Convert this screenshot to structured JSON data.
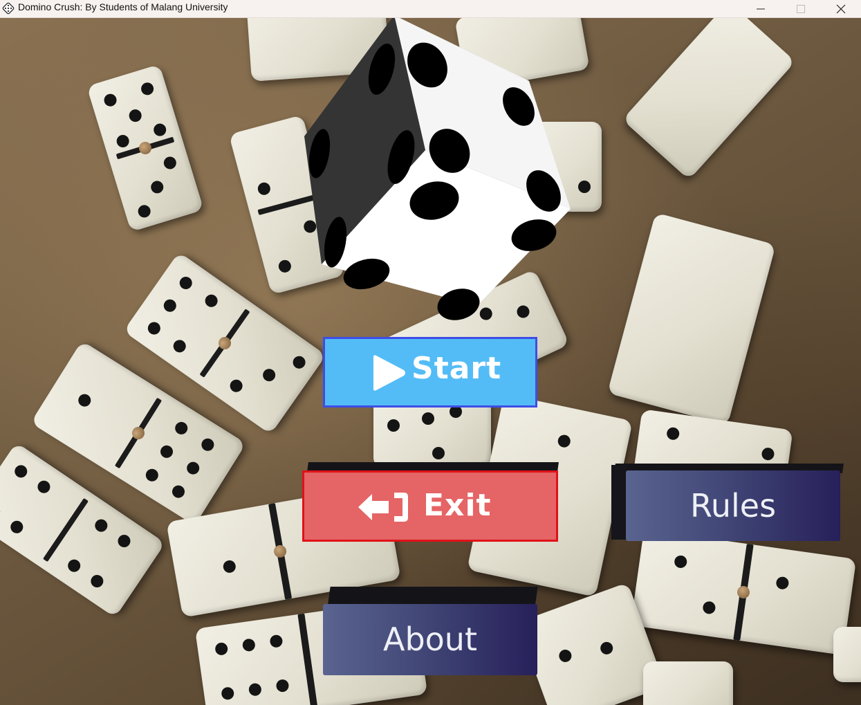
{
  "window": {
    "title": "Domino Crush: By Students of Malang University",
    "app_icon": "domino-dice-icon",
    "controls": [
      "minimize-icon",
      "maximize-icon",
      "close-icon"
    ]
  },
  "menu": {
    "start_label": "Start",
    "exit_label": "Exit",
    "rules_label": "Rules",
    "about_label": "About"
  },
  "icons": {
    "start": "play-icon",
    "exit": "exit-door-icon",
    "logo": "dice-icon"
  },
  "colors": {
    "start_fill": "#53bcf6",
    "start_border": "#3e4de6",
    "exit_fill": "#e56465",
    "exit_border": "#e01219",
    "navy_light": "#5a6490",
    "navy_dark": "#27205a"
  }
}
